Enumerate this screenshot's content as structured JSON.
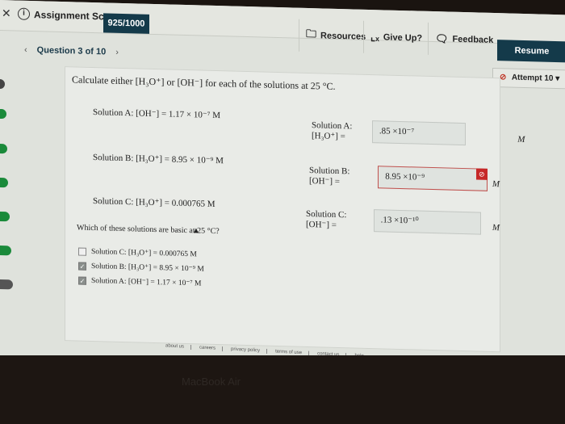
{
  "header": {
    "score_label": "Assignment Score:",
    "score_value": "925/1000",
    "resources_label": "Resources",
    "give_up_label": "Give Up?",
    "feedback_label": "Feedback",
    "resume_label": "Resume"
  },
  "nav": {
    "question_label": "Question 3 of 10",
    "attempt_label": "Attempt 10"
  },
  "question": {
    "prompt": "Calculate either [H₃O⁺] or [OH⁻] for each of the solutions at 25 °C.",
    "given": [
      {
        "label": "Solution A: [OH⁻] = 1.17 × 10⁻⁷ M"
      },
      {
        "label": "Solution B: [H₃O⁺] = 8.95 × 10⁻⁹ M"
      },
      {
        "label": "Solution C: [H₃O⁺] = 0.000765 M"
      }
    ],
    "answers": [
      {
        "label": "Solution A: [H₃O⁺] =",
        "value": ".85  ×10⁻⁷",
        "unit": "M",
        "status": "neutral"
      },
      {
        "label": "Solution B: [OH⁻] =",
        "value": "8.95  ×10⁻⁹",
        "unit": "M",
        "status": "incorrect"
      },
      {
        "label": "Solution C: [OH⁻] =",
        "value": ".13  ×10⁻¹⁰",
        "unit": "M",
        "status": "neutral"
      }
    ],
    "sub_question": "Which of these solutions are basic at 25 °C?",
    "options": [
      {
        "label": "Solution C: [H₃O⁺] = 0.000765 M",
        "checked": false
      },
      {
        "label": "Solution B: [H₃O⁺] = 8.95 × 10⁻⁹ M",
        "checked": true
      },
      {
        "label": "Solution A: [OH⁻] = 1.17 × 10⁻⁷ M",
        "checked": true
      }
    ]
  },
  "footer": {
    "links": [
      "about us",
      "careers",
      "privacy policy",
      "terms of use",
      "contact us",
      "help"
    ]
  },
  "device": {
    "brand": "MacBook Air"
  },
  "colors": {
    "primary": "#143a4a",
    "error": "#c62828",
    "progress_green": "#1a8a3a"
  }
}
